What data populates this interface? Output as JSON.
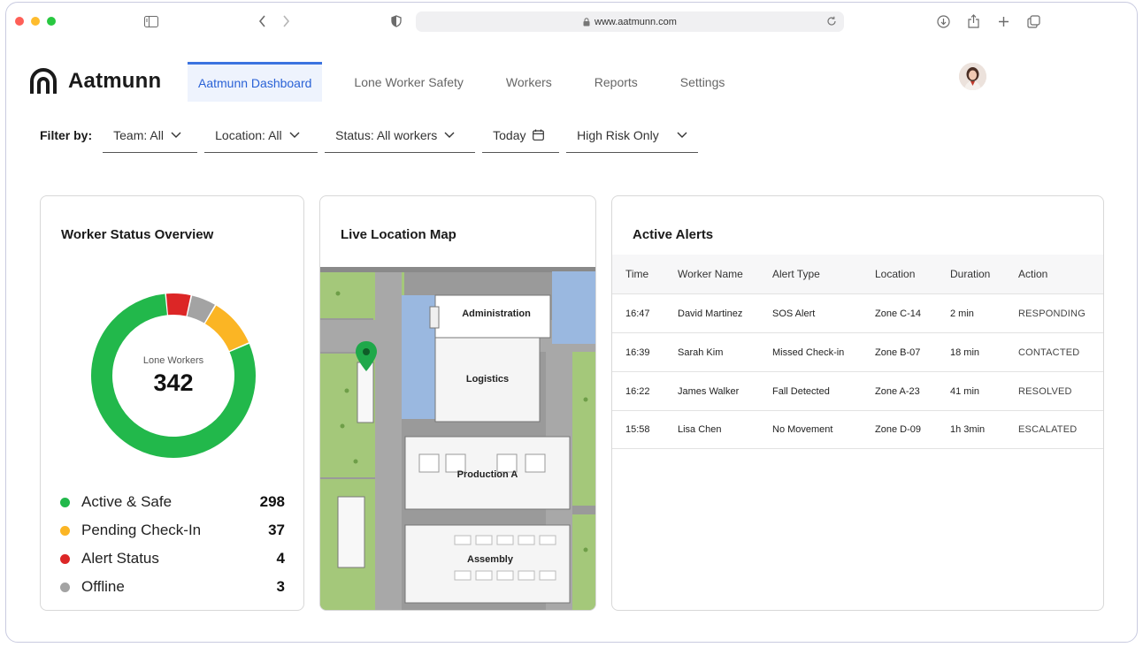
{
  "browser": {
    "url": "www.aatmunn.com"
  },
  "brand": {
    "name": "Aatmunn",
    "accent": "#3b73e0"
  },
  "nav": {
    "items": [
      {
        "label": "Aatmunn Dashboard",
        "active": true
      },
      {
        "label": "Lone Worker Safety"
      },
      {
        "label": "Workers"
      },
      {
        "label": "Reports"
      },
      {
        "label": "Settings"
      }
    ]
  },
  "filters": {
    "label": "Filter by:",
    "team": "Team: All",
    "location": "Location: All",
    "status": "Status: All workers",
    "date": "Today",
    "risk": "High Risk Only"
  },
  "worker_status": {
    "title": "Worker Status Overview",
    "center_label": "Lone Workers",
    "center_value": "342",
    "segments": [
      {
        "label": "Active & Safe",
        "count": 298,
        "color": "#22b84b"
      },
      {
        "label": "Pending Check-In",
        "count": 37,
        "color": "#fbb524"
      },
      {
        "label": "Alert Status",
        "count": 4,
        "color": "#dc2626"
      },
      {
        "label": "Offline",
        "count": 3,
        "color": "#a3a3a3"
      }
    ]
  },
  "map": {
    "title": "Live Location Map",
    "buildings": [
      "Administration",
      "Logistics",
      "Production A",
      "Assembly"
    ]
  },
  "alerts": {
    "title": "Active Alerts",
    "columns": [
      "Time",
      "Worker Name",
      "Alert Type",
      "Location",
      "Duration",
      "Action"
    ],
    "rows": [
      {
        "time": "16:47",
        "name": "David Martinez",
        "type": "SOS Alert",
        "location": "Zone C-14",
        "duration": "2 min",
        "action": "RESPONDING"
      },
      {
        "time": "16:39",
        "name": "Sarah Kim",
        "type": "Missed Check-in",
        "location": "Zone B-07",
        "duration": "18 min",
        "action": "CONTACTED"
      },
      {
        "time": "16:22",
        "name": "James Walker",
        "type": "Fall Detected",
        "location": "Zone A-23",
        "duration": "41 min",
        "action": "RESOLVED"
      },
      {
        "time": "15:58",
        "name": "Lisa Chen",
        "type": "No Movement",
        "location": "Zone D-09",
        "duration": "1h 3min",
        "action": "ESCALATED"
      }
    ]
  }
}
